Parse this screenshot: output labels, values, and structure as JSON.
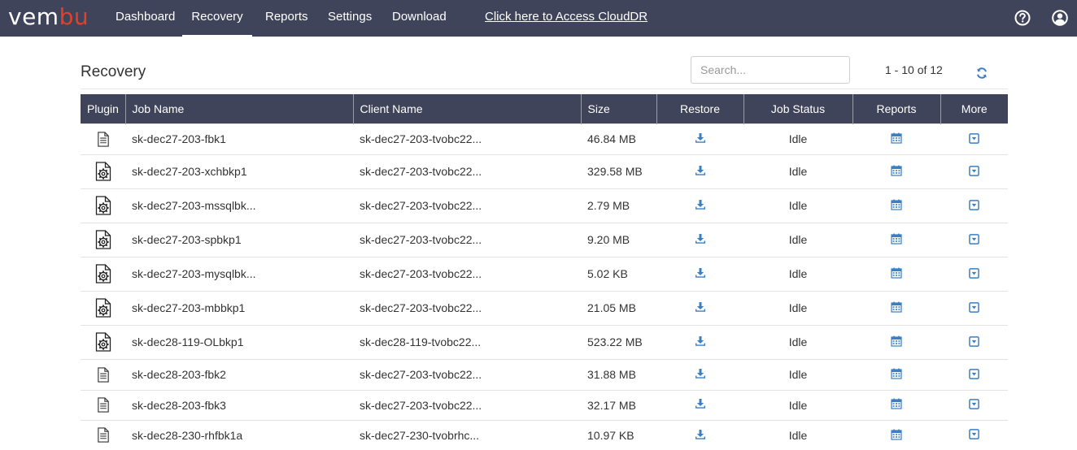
{
  "app": {
    "brand_pre": "vem",
    "brand_accent": "bu",
    "colors": {
      "topbar": "#40445a",
      "accent": "#e2402c",
      "icon_blue": "#3a7fc4"
    }
  },
  "nav": {
    "items": [
      {
        "label": "Dashboard",
        "active": false
      },
      {
        "label": "Recovery",
        "active": true
      },
      {
        "label": "Reports",
        "active": false
      },
      {
        "label": "Settings",
        "active": false
      },
      {
        "label": "Download",
        "active": false
      }
    ],
    "cloud_link": "Click here to Access CloudDR",
    "icons": [
      "help-icon",
      "user-icon"
    ]
  },
  "page": {
    "title": "Recovery",
    "search_placeholder": "Search...",
    "pagination": "1 - 10 of 12"
  },
  "table": {
    "headers": [
      "Plugin",
      "Job Name",
      "Client Name",
      "Size",
      "Restore",
      "Job Status",
      "Reports",
      "More"
    ],
    "rows": [
      {
        "plugin": "file-document-icon",
        "job": "sk-dec27-203-fbk1",
        "client": "sk-dec27-203-tvobc22...",
        "size": "46.84 MB",
        "status": "Idle"
      },
      {
        "plugin": "gear-document-icon",
        "job": "sk-dec27-203-xchbkp1",
        "client": "sk-dec27-203-tvobc22...",
        "size": "329.58 MB",
        "status": "Idle"
      },
      {
        "plugin": "gear-document-icon",
        "job": "sk-dec27-203-mssqlbk...",
        "client": "sk-dec27-203-tvobc22...",
        "size": "2.79 MB",
        "status": "Idle"
      },
      {
        "plugin": "gear-document-icon",
        "job": "sk-dec27-203-spbkp1",
        "client": "sk-dec27-203-tvobc22...",
        "size": "9.20 MB",
        "status": "Idle"
      },
      {
        "plugin": "gear-document-icon",
        "job": "sk-dec27-203-mysqlbk...",
        "client": "sk-dec27-203-tvobc22...",
        "size": "5.02 KB",
        "status": "Idle"
      },
      {
        "plugin": "gear-document-icon",
        "job": "sk-dec27-203-mbbkp1",
        "client": "sk-dec27-203-tvobc22...",
        "size": "21.05 MB",
        "status": "Idle"
      },
      {
        "plugin": "gear-document-icon",
        "job": "sk-dec28-119-OLbkp1",
        "client": "sk-dec28-119-tvobc22...",
        "size": "523.22 MB",
        "status": "Idle"
      },
      {
        "plugin": "file-document-icon",
        "job": "sk-dec28-203-fbk2",
        "client": "sk-dec27-203-tvobc22...",
        "size": "31.88 MB",
        "status": "Idle"
      },
      {
        "plugin": "file-document-icon",
        "job": "sk-dec28-203-fbk3",
        "client": "sk-dec27-203-tvobc22...",
        "size": "32.17 MB",
        "status": "Idle"
      },
      {
        "plugin": "file-document-icon",
        "job": "sk-dec28-230-rhfbk1a",
        "client": "sk-dec27-230-tvobrhc...",
        "size": "10.97 KB",
        "status": "Idle"
      }
    ]
  }
}
